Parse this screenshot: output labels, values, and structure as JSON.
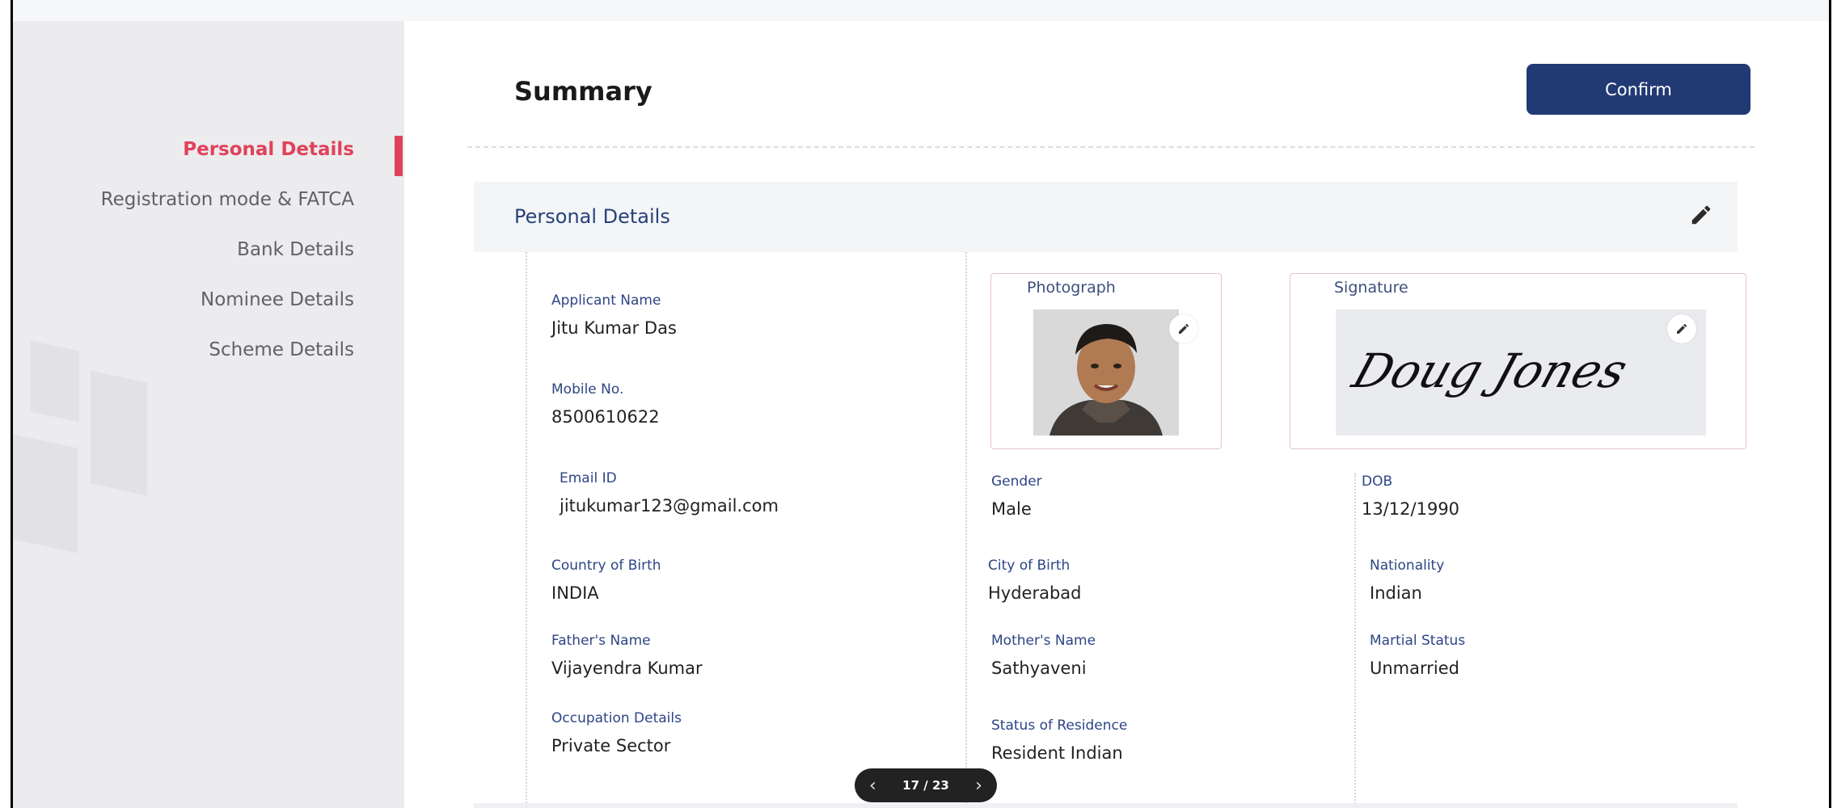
{
  "sidebar": {
    "items": [
      {
        "label": "Personal  Details",
        "active": true
      },
      {
        "label": "Registration mode & FATCA"
      },
      {
        "label": "Bank Details"
      },
      {
        "label": "Nominee Details"
      },
      {
        "label": "Scheme Details"
      }
    ],
    "accent_color": "#e0425a"
  },
  "main": {
    "title": "Summary",
    "confirm_label": "Confirm",
    "section_title": "Personal Details",
    "photograph_label": "Photograph",
    "signature_label": "Signature",
    "signature_text": "Doug Jones",
    "fields": {
      "applicant_name": {
        "label": "Applicant Name",
        "value": "Jitu Kumar Das"
      },
      "mobile": {
        "label": "Mobile No.",
        "value": "8500610622"
      },
      "email": {
        "label": "Email ID",
        "value": "jitukumar123@gmail.com"
      },
      "gender": {
        "label": "Gender",
        "value": "Male"
      },
      "dob": {
        "label": "DOB",
        "value": "13/12/1990"
      },
      "country_of_birth": {
        "label": "Country of Birth",
        "value": "INDIA"
      },
      "city_of_birth": {
        "label": "City of Birth",
        "value": "Hyderabad"
      },
      "nationality": {
        "label": "Nationality",
        "value": "Indian"
      },
      "father_name": {
        "label": "Father's Name",
        "value": "Vijayendra Kumar"
      },
      "mother_name": {
        "label": "Mother's Name",
        "value": "Sathyaveni"
      },
      "marital_status": {
        "label": "Martial Status",
        "value": "Unmarried"
      },
      "occupation": {
        "label": "Occupation Details",
        "value": "Private Sector"
      },
      "residence_status": {
        "label": "Status of Residence",
        "value": "Resident Indian"
      }
    }
  },
  "pager": {
    "text": "17 / 23"
  },
  "colors": {
    "primary": "#223a73",
    "label": "#2d4585"
  }
}
